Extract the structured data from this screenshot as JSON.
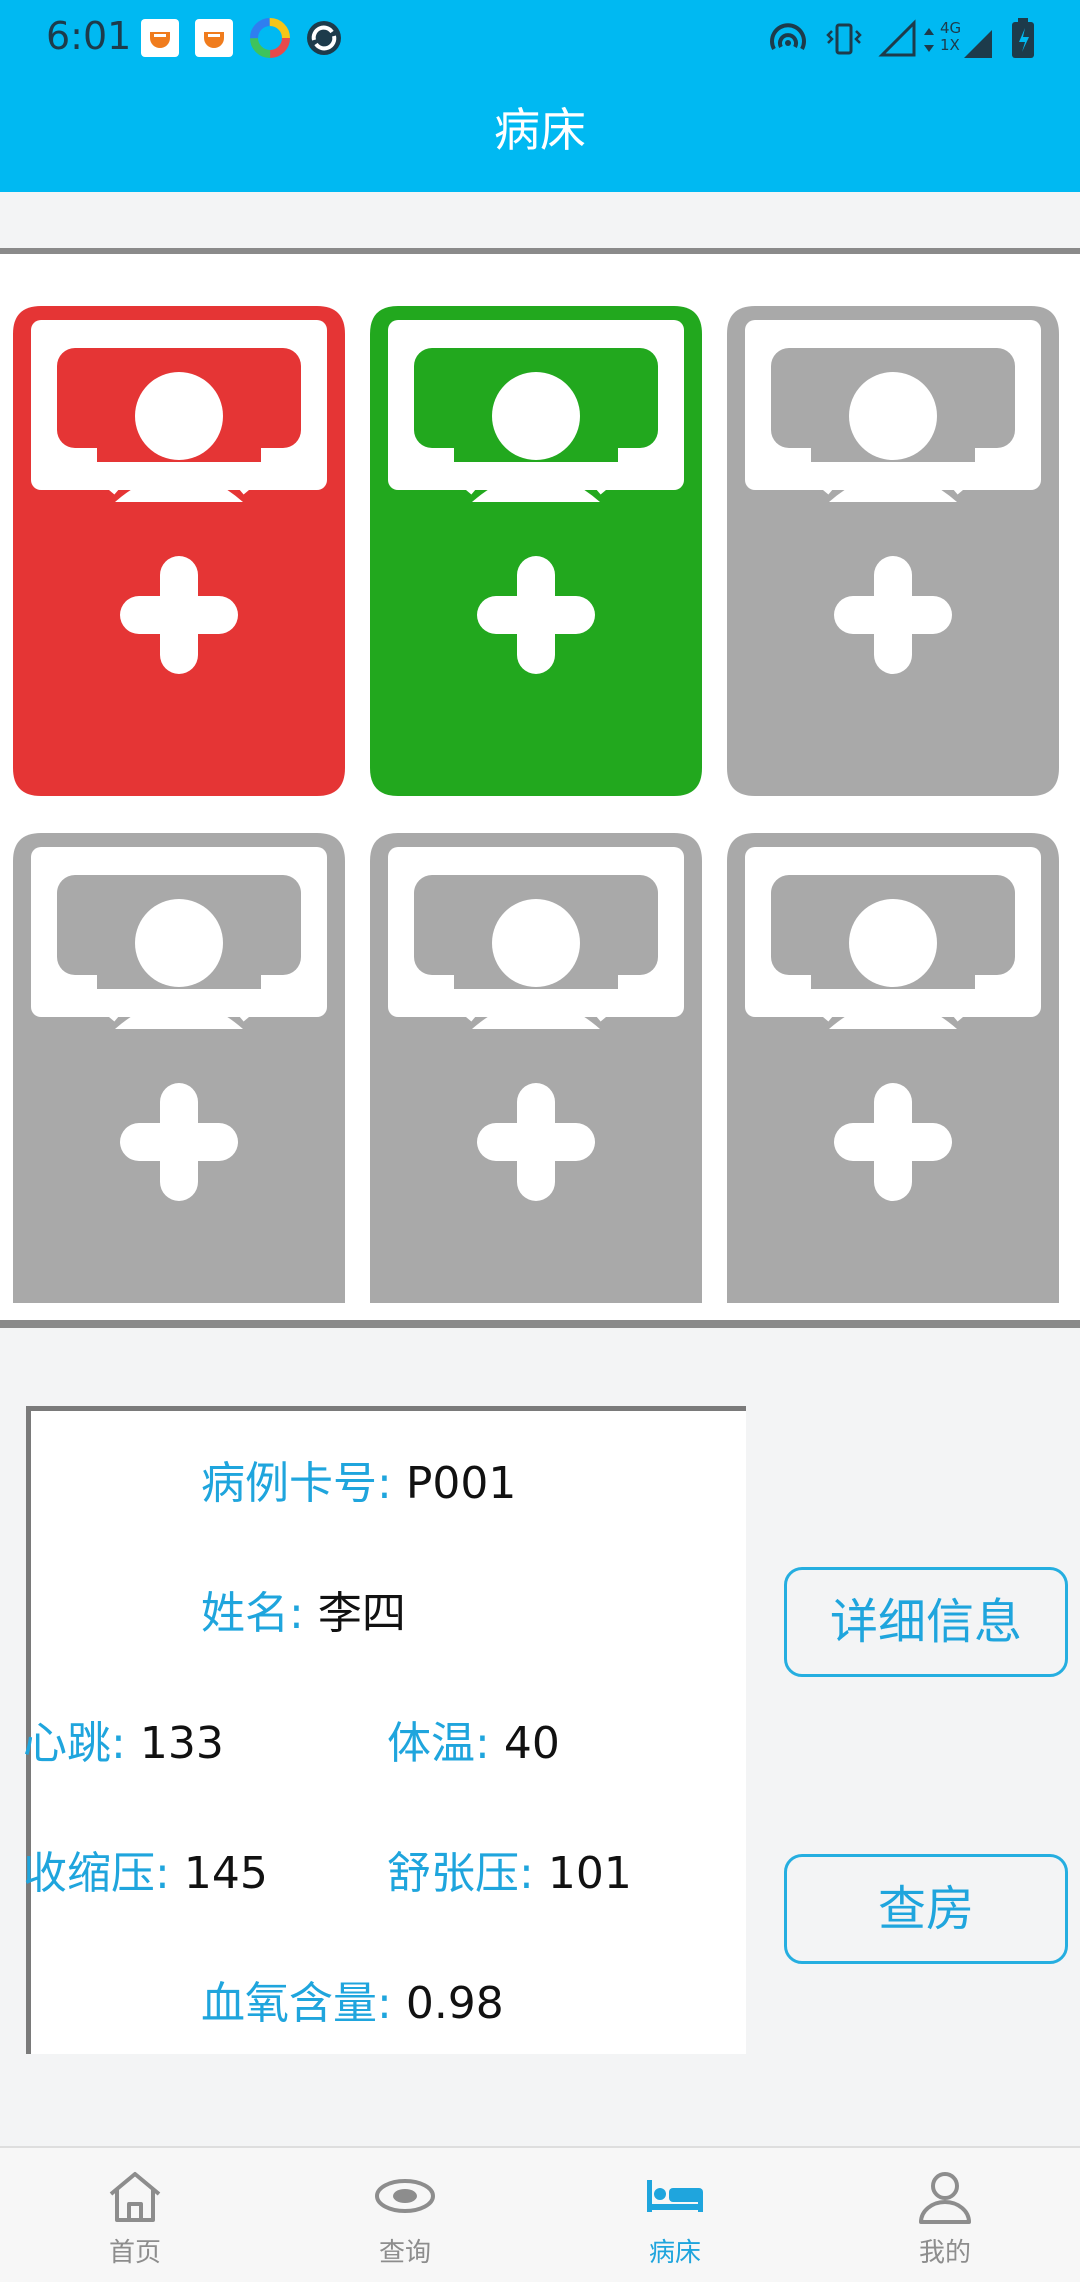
{
  "status_bar": {
    "time": "6:01",
    "network_label": "4G 1X"
  },
  "app_bar": {
    "title": "病床"
  },
  "beds": [
    {
      "status_color": "#e53535"
    },
    {
      "status_color": "#22a81e"
    },
    {
      "status_color": "#a9a9a9"
    },
    {
      "status_color": "#a9a9a9"
    },
    {
      "status_color": "#a9a9a9"
    },
    {
      "status_color": "#a9a9a9"
    }
  ],
  "patient": {
    "card_label": "病例卡号:",
    "card_value": "P001",
    "name_label": "姓名:",
    "name_value": "李四",
    "heart_label": "心跳:",
    "heart_value": "133",
    "temp_label": "体温:",
    "temp_value": "40",
    "systolic_label": "收缩压:",
    "systolic_value": "145",
    "diastolic_label": "舒张压:",
    "diastolic_value": "101",
    "oxygen_label": "血氧含量:",
    "oxygen_value": "0.98"
  },
  "actions": {
    "details": "详细信息",
    "round": "查房"
  },
  "bottom_nav": [
    {
      "label": "首页",
      "icon": "home-icon",
      "active": false
    },
    {
      "label": "查询",
      "icon": "eye-icon",
      "active": false
    },
    {
      "label": "病床",
      "icon": "bed-icon",
      "active": true
    },
    {
      "label": "我的",
      "icon": "user-icon",
      "active": false
    }
  ],
  "colors": {
    "primary": "#00b9f2",
    "accent_text": "#1fa5dd"
  }
}
